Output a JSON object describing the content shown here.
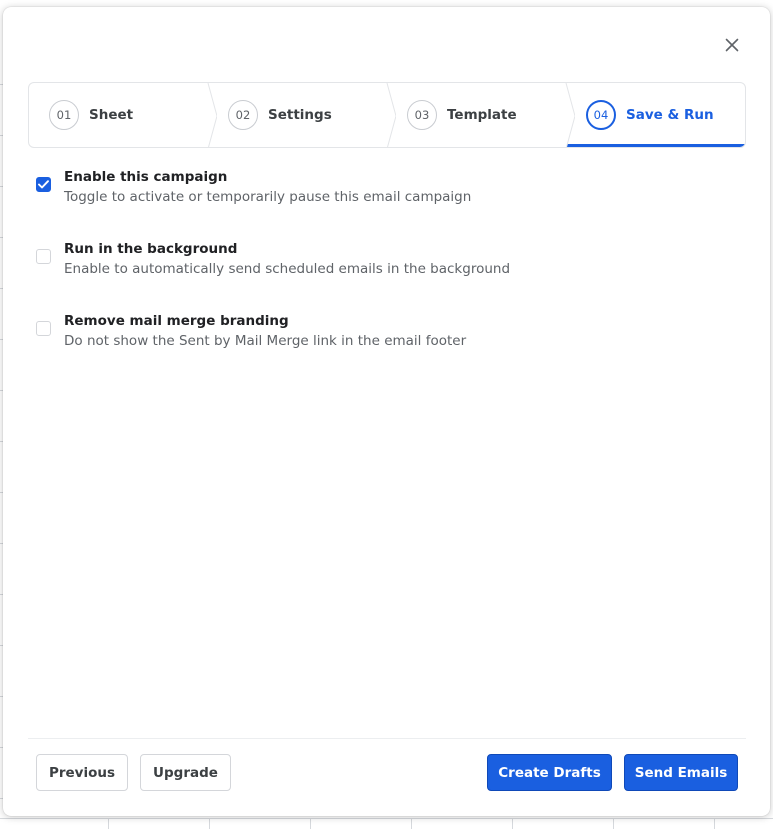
{
  "close_icon": "close-icon",
  "steps": [
    {
      "number": "01",
      "label": "Sheet",
      "active": false
    },
    {
      "number": "02",
      "label": "Settings",
      "active": false
    },
    {
      "number": "03",
      "label": "Template",
      "active": false
    },
    {
      "number": "04",
      "label": "Save & Run",
      "active": true
    }
  ],
  "options": [
    {
      "title": "Enable this campaign",
      "description": "Toggle to activate or temporarily pause this email campaign",
      "checked": true
    },
    {
      "title": "Run in the background",
      "description": "Enable to automatically send scheduled emails in the background",
      "checked": false
    },
    {
      "title": "Remove mail merge branding",
      "description": "Do not show the Sent by Mail Merge link in the email footer",
      "checked": false
    }
  ],
  "footer": {
    "previous_label": "Previous",
    "upgrade_label": "Upgrade",
    "create_drafts_label": "Create Drafts",
    "send_emails_label": "Send Emails"
  },
  "colors": {
    "accent": "#1a5fe0",
    "border": "#e3e5e8"
  }
}
